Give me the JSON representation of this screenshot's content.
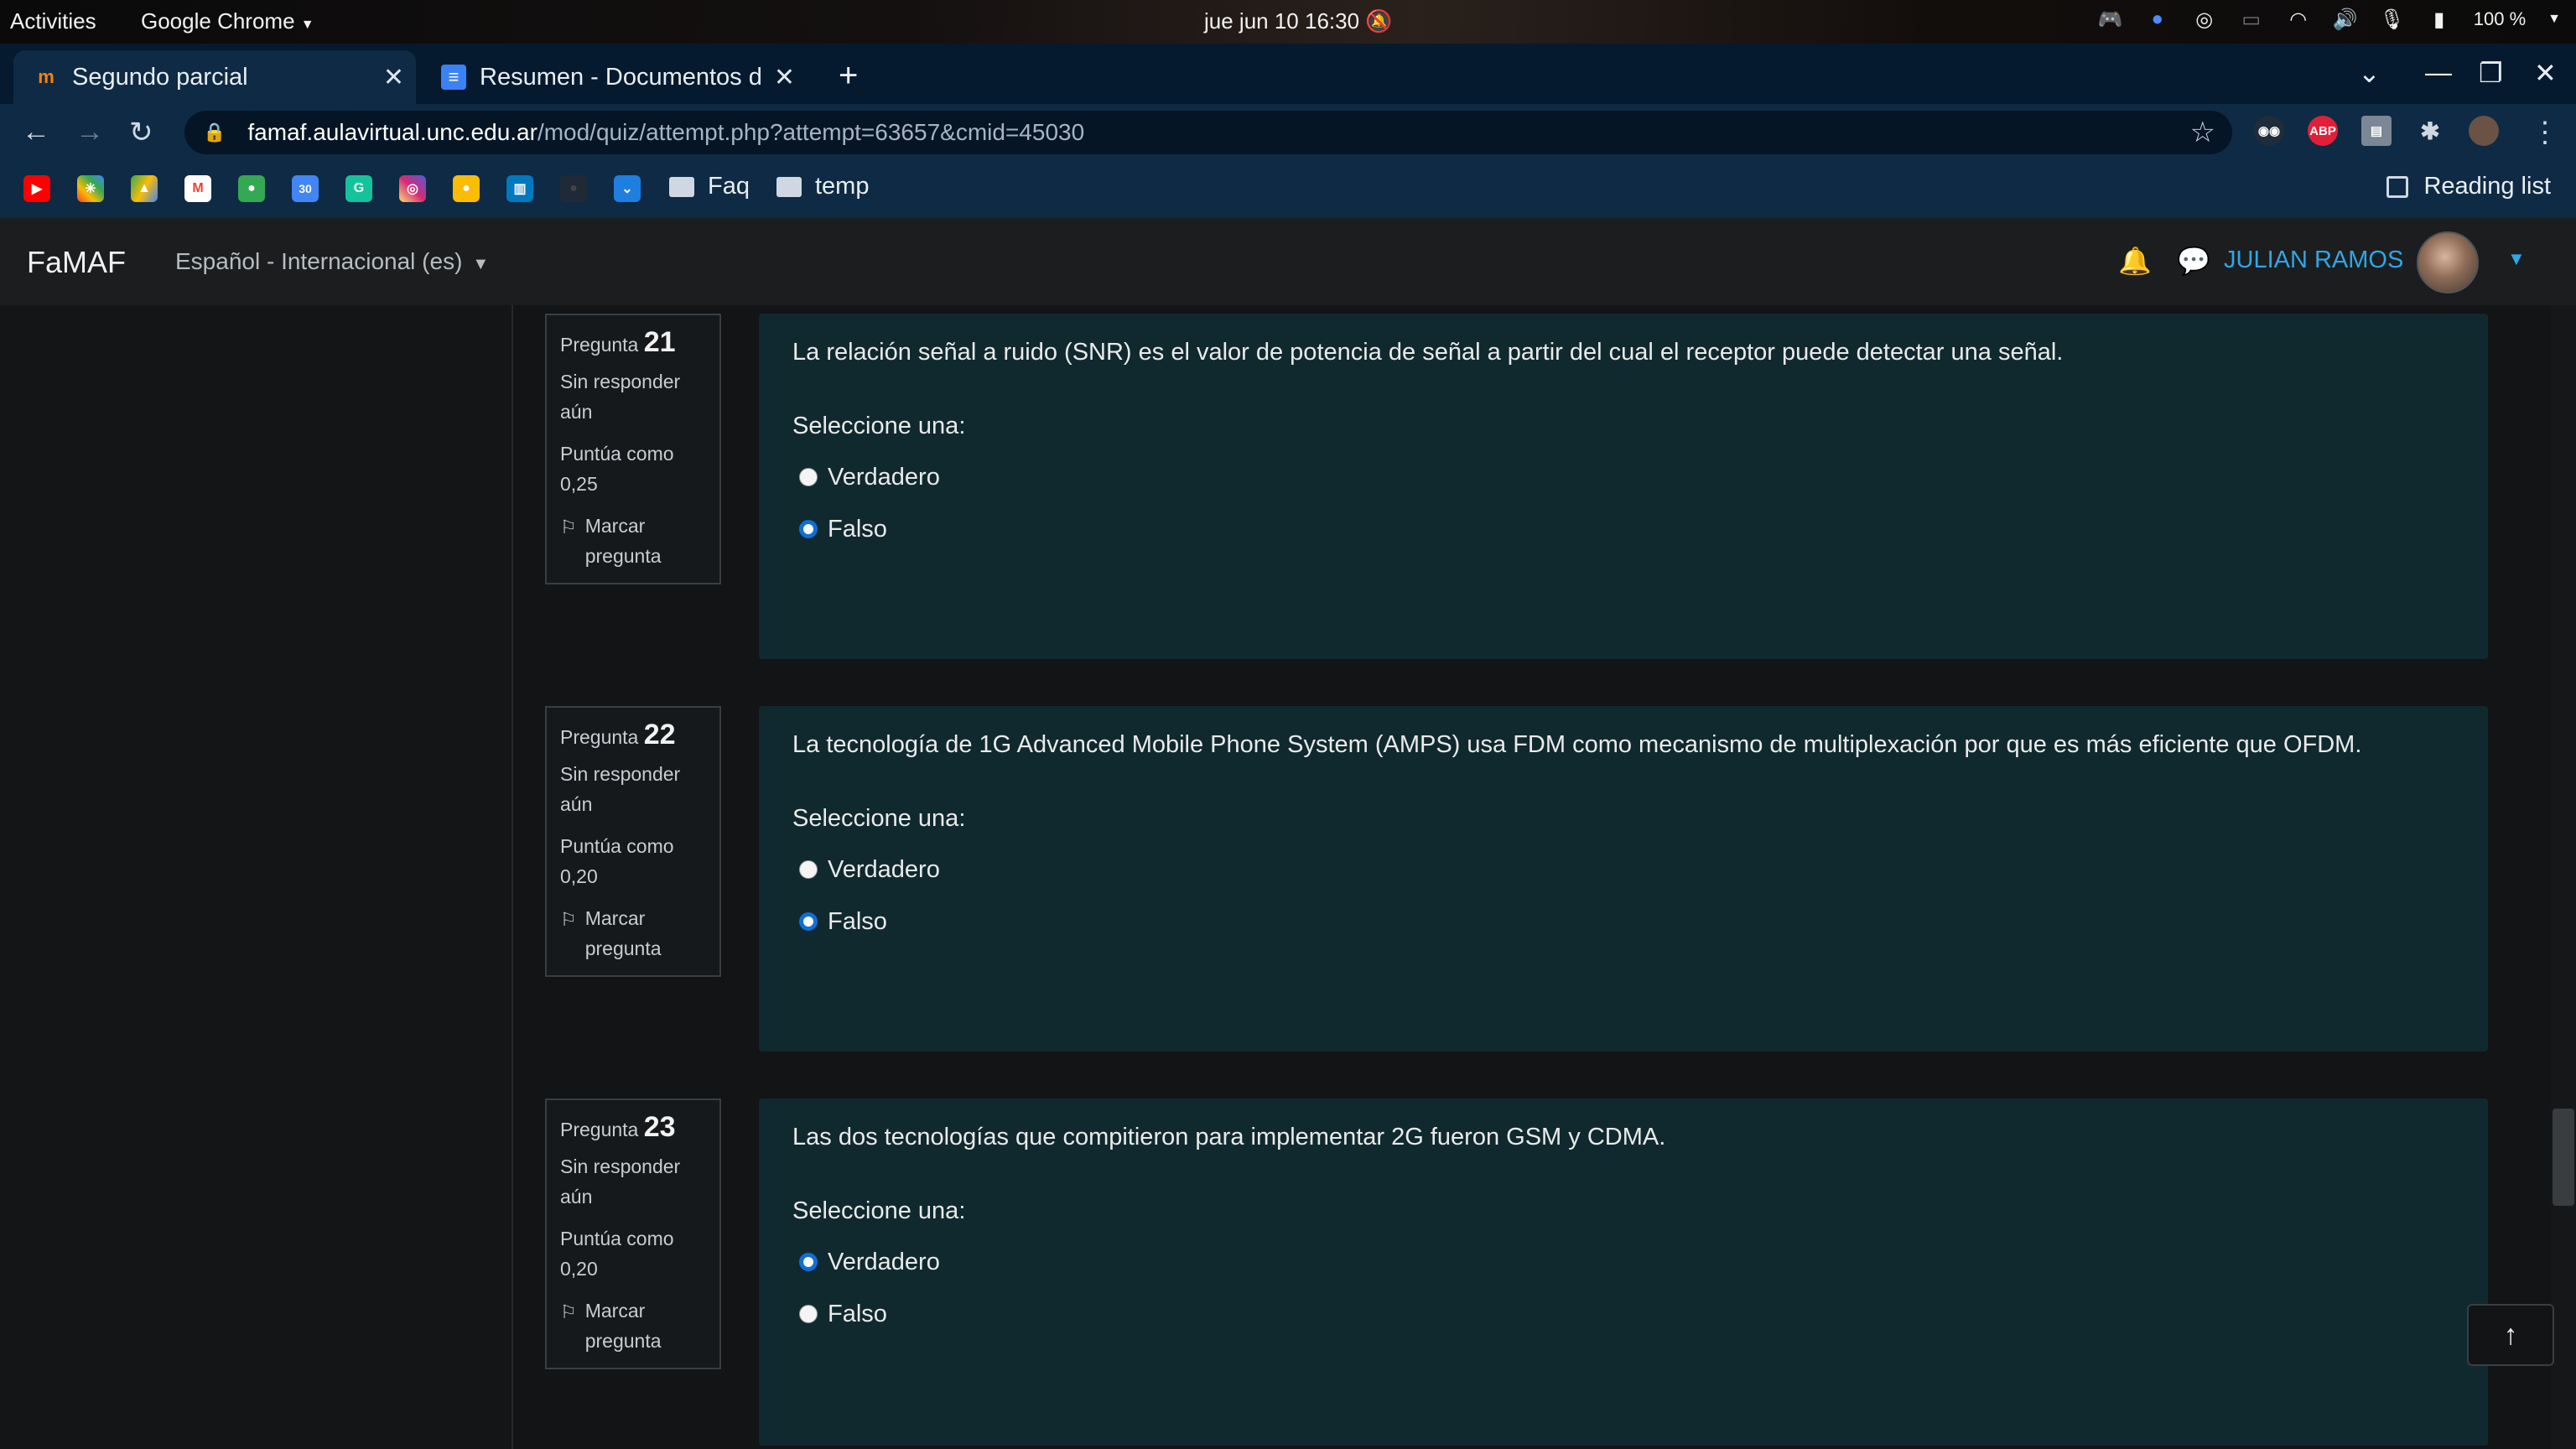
{
  "gnome": {
    "activities": "Activities",
    "app_name": "Google Chrome",
    "clock": "jue jun 10  16:30",
    "battery": "100 %",
    "tray_icons": [
      "discord-icon",
      "zoom-icon",
      "whatsapp-icon",
      "input-icon",
      "wifi-icon",
      "volume-icon",
      "mic-icon",
      "battery-icon"
    ]
  },
  "browser": {
    "tabs": [
      {
        "title": "Segundo parcial",
        "favicon": "moodle-icon",
        "active": true
      },
      {
        "title": "Resumen - Documentos d",
        "favicon": "docs-icon",
        "active": false
      }
    ],
    "url_host": "famaf.aulavirtual.unc.edu.ar",
    "url_path": "/mod/quiz/attempt.php?attempt=63657&cmid=45030",
    "bookmarks_folders": [
      "Faq",
      "temp"
    ],
    "bookmark_icons": [
      "youtube-icon",
      "pinwheel-icon",
      "drive-icon",
      "gmail-icon",
      "maps-icon",
      "calendar-icon",
      "grammarly-icon",
      "instagram-icon",
      "keep-icon",
      "trello-icon",
      "github-icon",
      "pocket-icon"
    ],
    "calendar_day": "30",
    "reading_list": "Reading list",
    "extensions": [
      "tamper-icon",
      "adblock-icon",
      "clipboard-icon",
      "puzzle-icon",
      "profile-icon"
    ],
    "adblock_label": "ABP"
  },
  "moodle": {
    "brand": "FaMAF",
    "language": "Español - Internacional (es)",
    "user_name": "JULIAN RAMOS",
    "question_label": "Pregunta",
    "select_prompt": "Seleccione una:",
    "flag_label": "Marcar pregunta",
    "questions": [
      {
        "number": "21",
        "state": "Sin responder aún",
        "grade": "Puntúa como 0,25",
        "text": "La relación señal a ruido (SNR) es el valor de potencia de señal a partir del cual el receptor puede detectar una señal.",
        "options": [
          {
            "label": "Verdadero",
            "checked": false
          },
          {
            "label": "Falso",
            "checked": true
          }
        ]
      },
      {
        "number": "22",
        "state": "Sin responder aún",
        "grade": "Puntúa como 0,20",
        "text": "La tecnología de 1G Advanced Mobile Phone System (AMPS) usa FDM como mecanismo de multiplexación por que es más eficiente que OFDM.",
        "options": [
          {
            "label": "Verdadero",
            "checked": false
          },
          {
            "label": "Falso",
            "checked": true
          }
        ]
      },
      {
        "number": "23",
        "state": "Sin responder aún",
        "grade": "Puntúa como 0,20",
        "text": "Las dos tecnologías que compitieron para implementar 2G fueron GSM y CDMA.",
        "options": [
          {
            "label": "Verdadero",
            "checked": true
          },
          {
            "label": "Falso",
            "checked": false
          }
        ]
      }
    ]
  },
  "colors": {
    "accent_link": "#2fa6e6",
    "question_bg": "#10292f",
    "radio_checked": "#0e6fd6",
    "tab_strip": "#061a2f",
    "toolbar": "#0f2a44"
  }
}
